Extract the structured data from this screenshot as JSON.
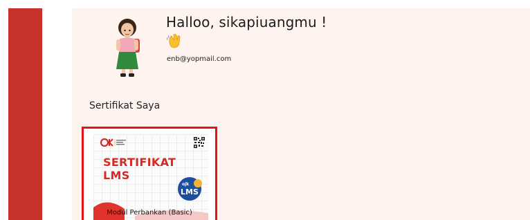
{
  "profile": {
    "greeting": "Halloo, sikapiuangmu !",
    "wave_emoji": "👋",
    "email": "enb@yopmail.com"
  },
  "certificates": {
    "section_title": "Sertifikat Saya",
    "items": [
      {
        "title_line1": "SERTIFIKAT",
        "title_line2": "LMS",
        "badge_label": "LMS",
        "issuer_logo": "OJK",
        "module_name": "Modul Perbankan (Basic)"
      }
    ]
  },
  "colors": {
    "sidebar": "#c8322d",
    "panel_background": "#fff3f0",
    "selection_border": "#e21216",
    "cert_accent": "#d42a25",
    "badge_blue": "#1c4fa0"
  }
}
